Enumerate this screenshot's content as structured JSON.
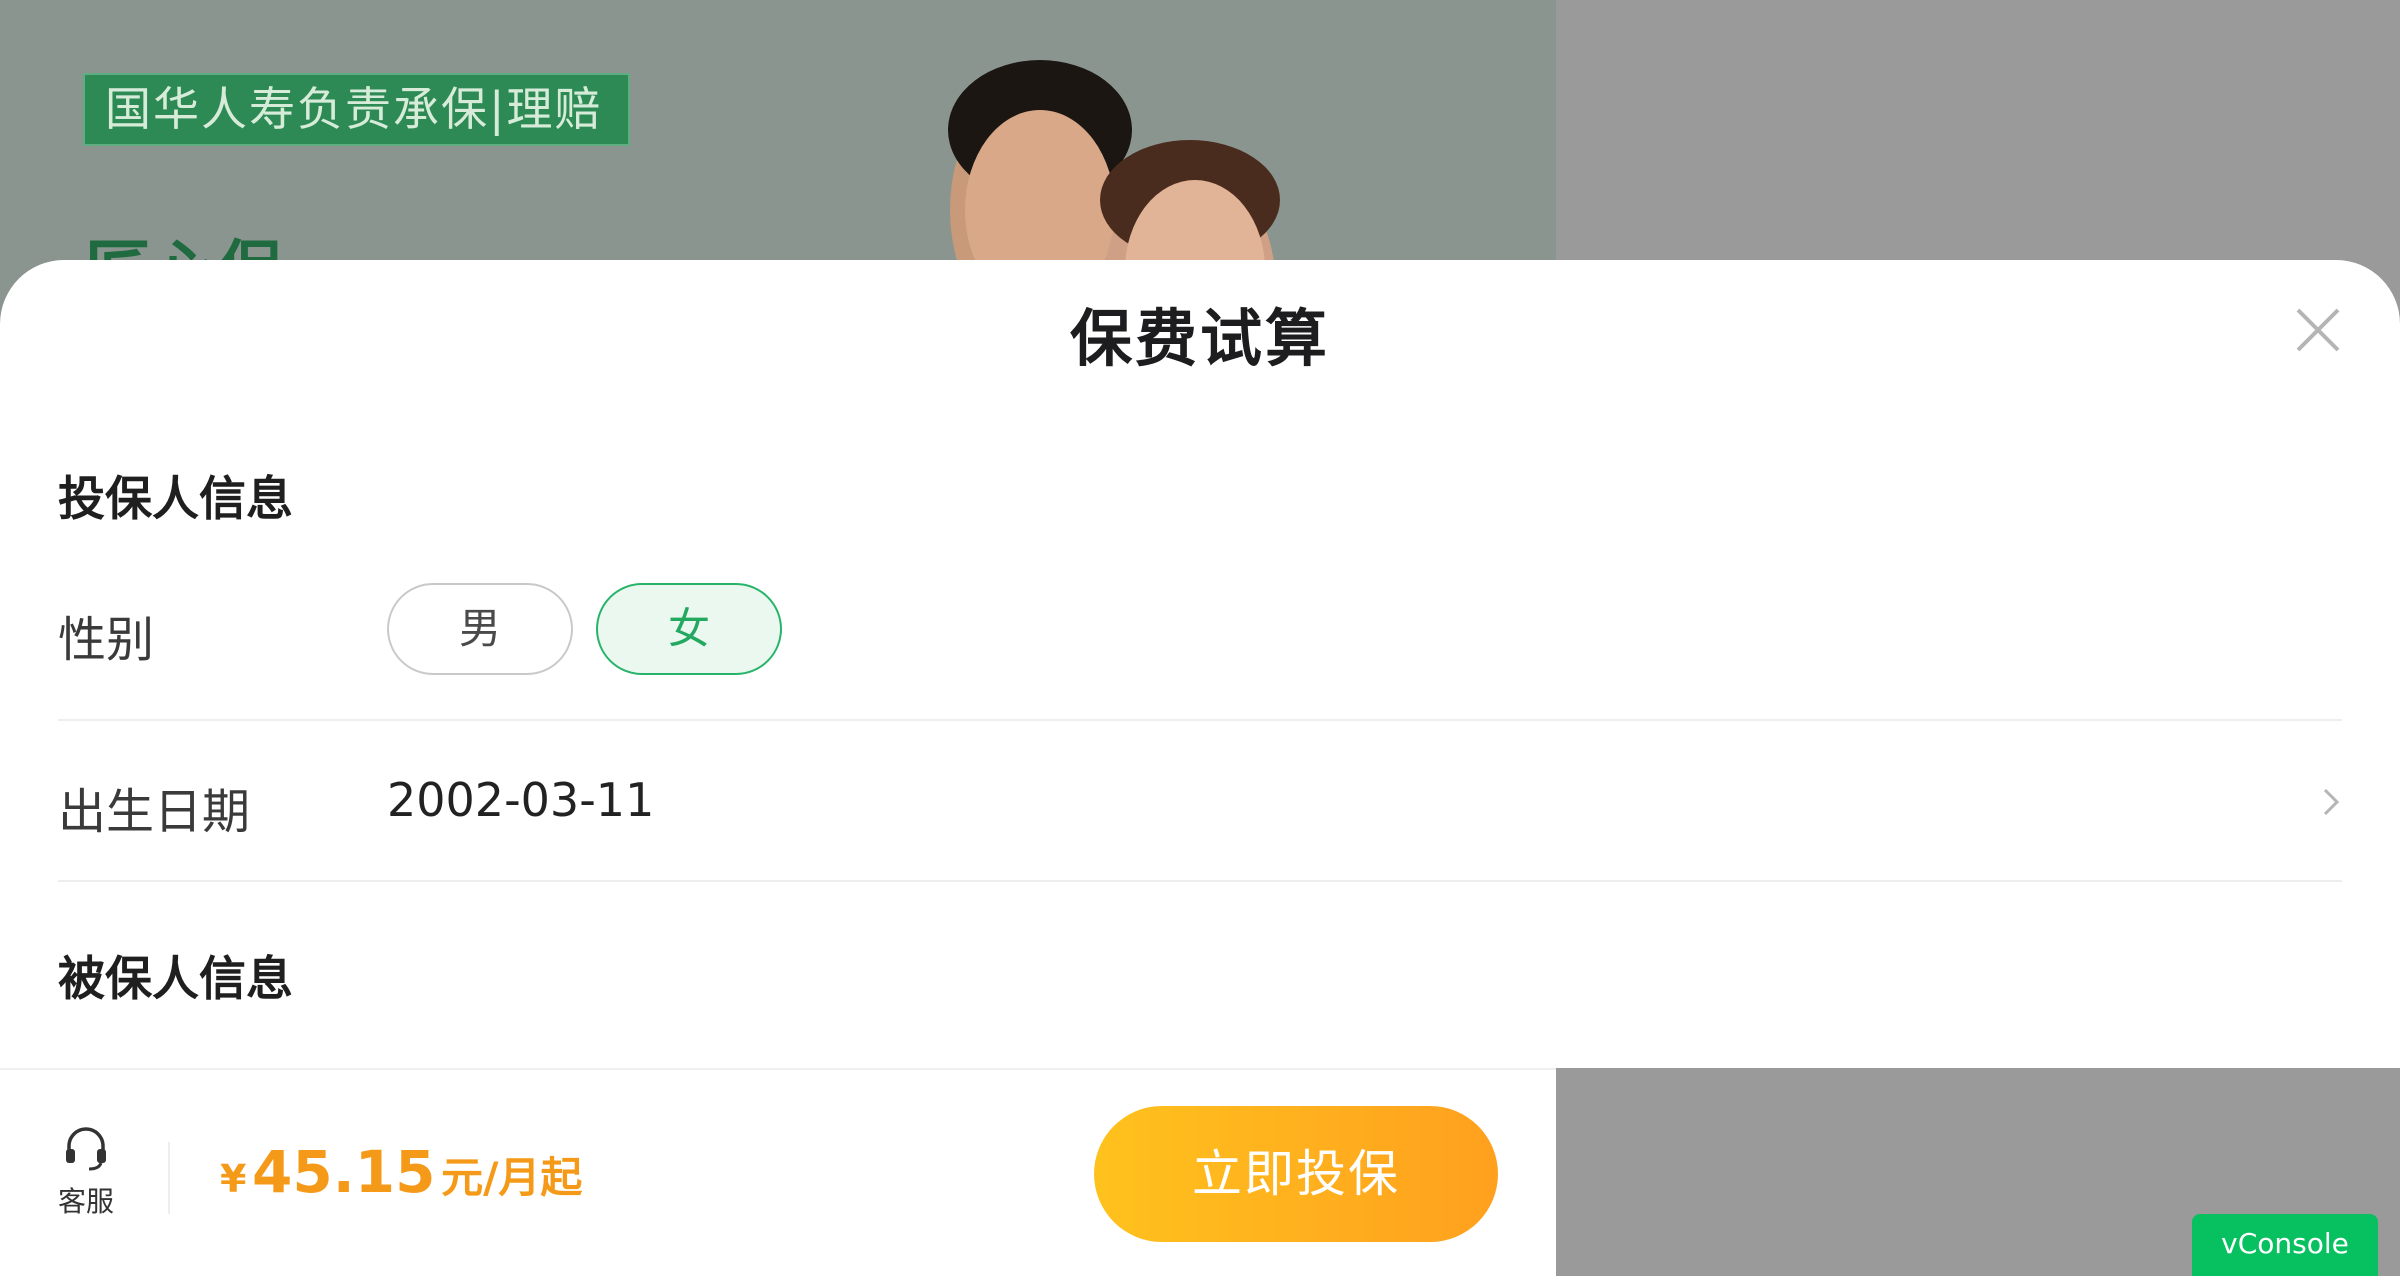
{
  "banner": {
    "tag": "国华人寿负责承保|理赔",
    "heading": "匠心保"
  },
  "modal": {
    "title": "保费试算",
    "close_icon": "close-icon",
    "policyholder_section": "投保人信息",
    "gender_label": "性别",
    "gender_options": [
      "男",
      "女"
    ],
    "gender_selected": "女",
    "birth_label": "出生日期",
    "birth_value": "2002-03-11",
    "insured_section": "被保人信息"
  },
  "bottom_bar": {
    "service_label": "客服",
    "service_icon": "headset-icon",
    "price_symbol": "¥",
    "price_value": "45.15",
    "price_unit": "元/月起",
    "buy_label": "立即投保"
  },
  "vconsole": {
    "label": "vConsole"
  },
  "colors": {
    "accent_green": "#27b46a",
    "price_orange": "#f59a18",
    "button_gradient_start": "#ffc21d",
    "button_gradient_end": "#ffa01e",
    "vconsole_green": "#07c160"
  }
}
